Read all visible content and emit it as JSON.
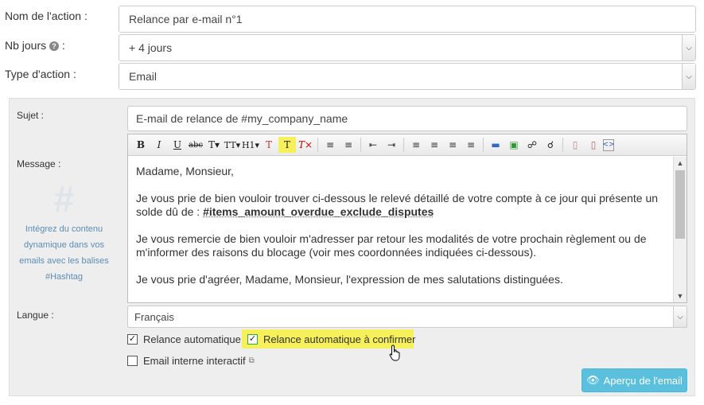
{
  "form": {
    "action_name_label": "Nom de l'action :",
    "action_name_value": "Relance par e-mail n°1",
    "nb_days_label": "Nb jours",
    "nb_days_suffix": ":",
    "nb_days_value": "+ 4 jours",
    "action_type_label": "Type d'action :",
    "action_type_value": "Email"
  },
  "panel": {
    "subject_label": "Sujet :",
    "subject_value": "E-mail de relance de #my_company_name",
    "message_label": "Message :",
    "hashtag_symbol": "#",
    "hashtag_help": "Intégrez du contenu dynamique dans vos emails avec les balises #Hashtag",
    "message": {
      "greeting": "Madame, Monsieur,",
      "p1_before": "Je vous prie de bien vouloir trouver ci-dessous le relevé détaillé de votre compte à ce jour qui présente un solde dû de : ",
      "p1_tag": "#items_amount_overdue_exclude_disputes",
      "p2": "Je vous remercie de bien vouloir m'adresser par retour les modalités de votre prochain règlement ou de m'informer des raisons du blocage (voir mes coordonnées indiquées ci-dessous).",
      "p3": "Je vous prie d'agréer, Madame, Monsieur, l'expression de mes salutations distinguées."
    },
    "language_label": "Langue :",
    "language_value": "Français",
    "auto_relance_label": "Relance automatique",
    "auto_relance_confirm_label": "Relance automatique à confirmer",
    "internal_email_label": "Email interne interactif",
    "preview_button": "Aperçu de l'email"
  },
  "colors": {
    "highlight": "#f6f05a",
    "button": "#5bc0de",
    "hashtag_text": "#5b8db5"
  }
}
